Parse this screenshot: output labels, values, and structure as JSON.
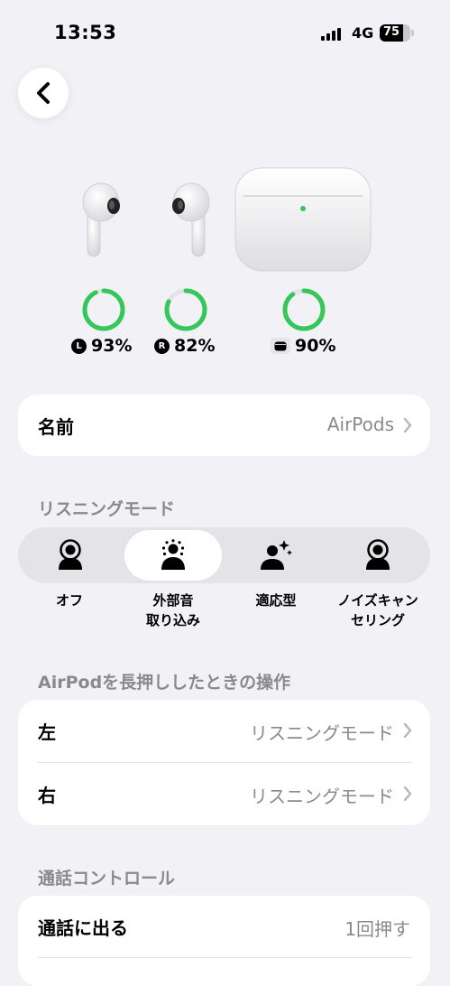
{
  "status_bar": {
    "time": "13:53",
    "network": "4G",
    "battery": "75",
    "battery_level": 0.75
  },
  "devices": {
    "left": {
      "badge": "L",
      "label": "93%",
      "level": 0.93
    },
    "right": {
      "badge": "R",
      "label": "82%",
      "level": 0.82
    },
    "case": {
      "label": "90%",
      "level": 0.9
    }
  },
  "name_row": {
    "label": "名前",
    "value": "AirPods"
  },
  "listening_modes": {
    "title": "リスニングモード",
    "selected": "外部音取り込み",
    "modes": [
      {
        "line1": "オフ",
        "line2": ""
      },
      {
        "line1": "外部音",
        "line2": "取り込み"
      },
      {
        "line1": "適応型",
        "line2": ""
      },
      {
        "line1": "ノイズキャン",
        "line2": "セリング"
      }
    ]
  },
  "press_hold": {
    "title": "AirPodを長押ししたときの操作",
    "rows": [
      {
        "label": "左",
        "value": "リスニングモード"
      },
      {
        "label": "右",
        "value": "リスニングモード"
      }
    ]
  },
  "call_controls": {
    "title": "通話コントロール",
    "rows": [
      {
        "label": "通話に出る",
        "value": "1回押す"
      }
    ]
  },
  "colors": {
    "ring": "#34c759",
    "ring_track": "#e3e3e8",
    "background": "#f2f1f6"
  }
}
